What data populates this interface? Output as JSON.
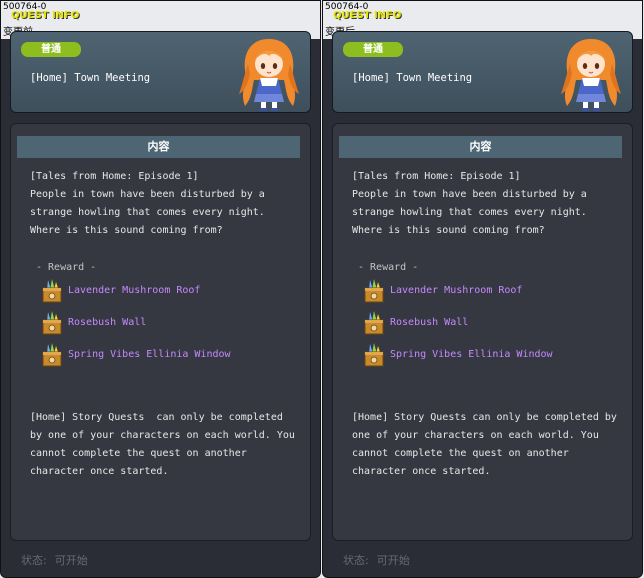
{
  "panels": [
    {
      "quest_id": "500764-0",
      "quest_info_label": "QUEST INFO",
      "version_label": "变更前",
      "category_badge": "普通",
      "quest_title": "[Home] Town Meeting",
      "section_title": "内容",
      "description_lines": [
        "[Tales from Home: Episode 1]",
        "People in town have been disturbed by a",
        "strange howling that comes every night.",
        "Where is this sound coming from?"
      ],
      "reward_label": "- Reward -",
      "rewards": [
        {
          "name": "Lavender Mushroom Roof",
          "icon": "furniture-box-icon"
        },
        {
          "name": "Rosebush Wall",
          "icon": "furniture-box-icon"
        },
        {
          "name": "Spring Vibes Ellinia Window",
          "icon": "furniture-box-icon"
        }
      ],
      "note_lines": [
        "[Home] Story Quests  can only be completed",
        "by one of your characters on each world. You",
        "cannot complete the quest on another",
        "character once started."
      ],
      "status_label": "状态:",
      "status_value": "可开始"
    },
    {
      "quest_id": "500764-0",
      "quest_info_label": "QUEST INFO",
      "version_label": "变更后",
      "category_badge": "普通",
      "quest_title": "[Home] Town Meeting",
      "section_title": "内容",
      "description_lines": [
        "[Tales from Home: Episode 1]",
        "People in town have been disturbed by a",
        "strange howling that comes every night.",
        "Where is this sound coming from?"
      ],
      "reward_label": "- Reward -",
      "rewards": [
        {
          "name": "Lavender Mushroom Roof",
          "icon": "furniture-box-icon"
        },
        {
          "name": "Rosebush Wall",
          "icon": "furniture-box-icon"
        },
        {
          "name": "Spring Vibes Ellinia Window",
          "icon": "furniture-box-icon"
        }
      ],
      "note_lines": [
        "[Home] Story Quests can only be completed by",
        "one of your characters on each world. You",
        "cannot complete the quest on another",
        "character once started."
      ],
      "status_label": "状态:",
      "status_value": "可开始"
    }
  ],
  "colors": {
    "panel_bg": "#2a2d35",
    "badge": "#8bbe1e",
    "quest_info": "#e6e600",
    "reward_text": "#c489ff"
  }
}
